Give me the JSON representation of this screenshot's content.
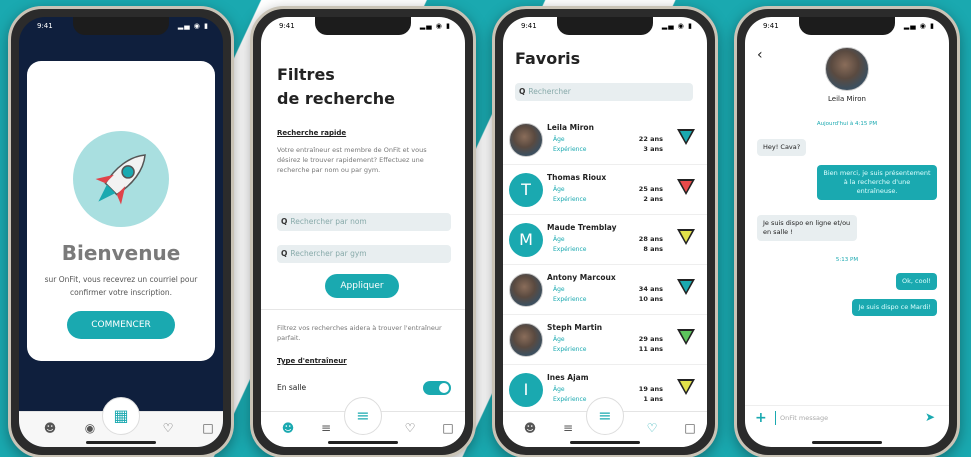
{
  "status_time": "9:41",
  "status_icons": "▂▄ ◉ ▮",
  "welcome": {
    "title": "Bienvenue",
    "message": "sur OnFit, vous recevrez un courriel pour confirmer votre inscription.",
    "button": "COMMENCER"
  },
  "filters": {
    "title_line1": "Filtres",
    "title_line2": "de recherche",
    "quick_label": "Recherche rapide",
    "quick_text": "Votre entraîneur est membre de OnFit et vous désirez le trouver rapidement? Effectuez une recherche par nom ou par gym.",
    "search_name_placeholder": "Rechercher par nom",
    "search_gym_placeholder": "Rechercher par gym",
    "apply_button": "Appliquer",
    "refine_text": "Filtrez vos recherches aidera à trouver l'entraîneur parfait.",
    "type_label": "Type d'entraîneur",
    "option_gym": "En salle"
  },
  "favorites": {
    "title": "Favoris",
    "search_placeholder": "Rechercher",
    "age_label": "Âge",
    "experience_label": "Expérience",
    "items": [
      {
        "name": "Leila Miron",
        "age": "22 ans",
        "experience": "3 ans",
        "initial": "",
        "photo": true,
        "color": "#1aa9b0"
      },
      {
        "name": "Thomas Rioux",
        "age": "25 ans",
        "experience": "2 ans",
        "initial": "T",
        "photo": false,
        "color": "#e84a4a"
      },
      {
        "name": "Maude Tremblay",
        "age": "28 ans",
        "experience": "8 ans",
        "initial": "M",
        "photo": false,
        "color": "#e0e04a"
      },
      {
        "name": "Antony Marcoux",
        "age": "34 ans",
        "experience": "10 ans",
        "initial": "",
        "photo": true,
        "color": "#1aa9b0"
      },
      {
        "name": "Steph Martin",
        "age": "29 ans",
        "experience": "11 ans",
        "initial": "",
        "photo": true,
        "color": "#5cc45c"
      },
      {
        "name": "Ines Ajam",
        "age": "19 ans",
        "experience": "1 ans",
        "initial": "I",
        "photo": false,
        "color": "#e0e04a"
      }
    ]
  },
  "chat": {
    "contact_name": "Leila Miron",
    "date1": "Aujourd'hui à 4:15 PM",
    "msg1": "Hey! Cava?",
    "msg2": "Bien merci, je suis présentement à la recherche d'une entraîneuse.",
    "msg3": "Je suis dispo en ligne et/ou en salle !",
    "date2": "5:13 PM",
    "msg4": "Ok, cool!",
    "msg5": "Je suis dispo ce Mardi!",
    "input_placeholder": "OnFit message"
  },
  "colors": {
    "accent": "#1aa9b0",
    "navy": "#0f1f3d"
  }
}
